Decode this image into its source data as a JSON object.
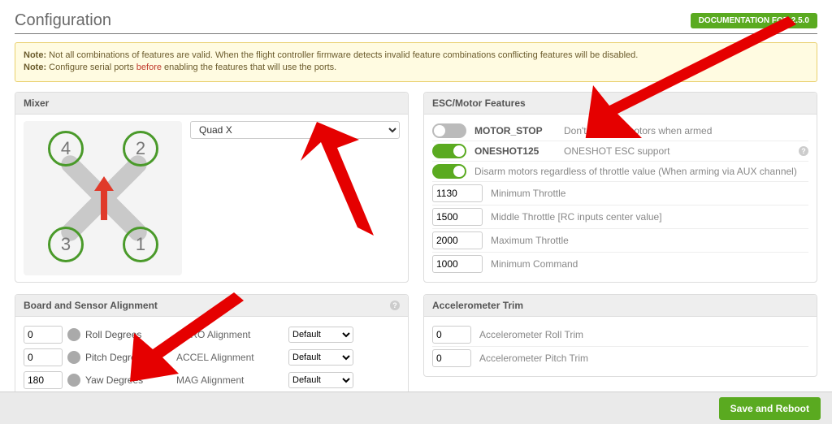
{
  "page_title": "Configuration",
  "doc_button": "DOCUMENTATION FOR 2.5.0",
  "note": {
    "prefix1": "Note:",
    "text1": " Not all combinations of features are valid. When the flight controller firmware detects invalid feature combinations conflicting features will be disabled.",
    "prefix2": "Note:",
    "text2a": " Configure serial ports ",
    "before": "before",
    "text2b": " enabling the features that will use the ports."
  },
  "mixer": {
    "title": "Mixer",
    "selected": "Quad X",
    "props": [
      "4",
      "2",
      "3",
      "1"
    ]
  },
  "esc": {
    "title": "ESC/Motor Features",
    "features": [
      {
        "on": false,
        "label": "MOTOR_STOP",
        "desc": "Don't spin the motors when armed"
      },
      {
        "on": true,
        "label": "ONESHOT125",
        "desc": "ONESHOT ESC support",
        "help": true
      },
      {
        "on": true,
        "label": "",
        "desc": "Disarm motors regardless of throttle value (When arming via AUX channel)"
      }
    ],
    "numeric": [
      {
        "value": "1130",
        "label": "Minimum Throttle"
      },
      {
        "value": "1500",
        "label": "Middle Throttle [RC inputs center value]"
      },
      {
        "value": "2000",
        "label": "Maximum Throttle"
      },
      {
        "value": "1000",
        "label": "Minimum Command"
      }
    ]
  },
  "board": {
    "title": "Board and Sensor Alignment",
    "rows": [
      {
        "value": "0",
        "axis": "Roll Degrees",
        "align_label": "GYRO Alignment",
        "align_value": "Default"
      },
      {
        "value": "0",
        "axis": "Pitch Degrees",
        "align_label": "ACCEL Alignment",
        "align_value": "Default"
      },
      {
        "value": "180",
        "axis": "Yaw Degrees",
        "align_label": "MAG Alignment",
        "align_value": "Default"
      }
    ]
  },
  "accel": {
    "title": "Accelerometer Trim",
    "rows": [
      {
        "value": "0",
        "label": "Accelerometer Roll Trim"
      },
      {
        "value": "0",
        "label": "Accelerometer Pitch Trim"
      }
    ]
  },
  "save_button": "Save and Reboot"
}
